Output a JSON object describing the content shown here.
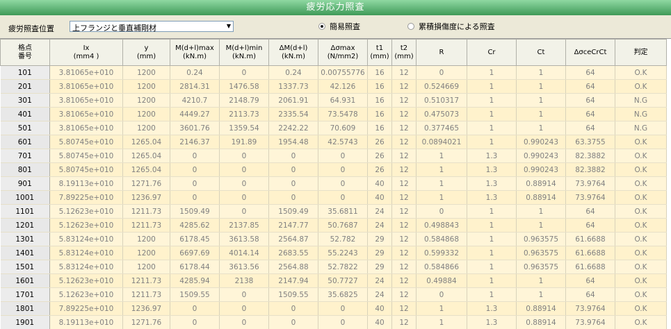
{
  "title": "疲労応力照査",
  "filter": {
    "label": "疲労照査位置",
    "location_value": "上フランジと垂直補剛材",
    "dropdown_icon": "▼",
    "radio_simple": "簡易照査",
    "radio_cumulative": "累積損傷度による照査",
    "selected": "simple"
  },
  "table": {
    "headers": [
      "格点\n番号",
      "Ix\n(mm4 )",
      "y\n(mm)",
      "M(d+l)max\n(kN.m)",
      "M(d+l)min\n(kN.m)",
      "ΔM(d+l)\n(kN.m)",
      "Δσmax\n(N/mm2)",
      "t1\n(mm)",
      "t2\n(mm)",
      "R",
      "Cr",
      "Ct",
      "ΔσceCrCt",
      "判定"
    ],
    "rows": [
      [
        "101",
        "3.81065e+010",
        "1200",
        "0.24",
        "0",
        "0.24",
        "0.00755776",
        "16",
        "12",
        "0",
        "1",
        "1",
        "64",
        "O.K"
      ],
      [
        "201",
        "3.81065e+010",
        "1200",
        "2814.31",
        "1476.58",
        "1337.73",
        "42.126",
        "16",
        "12",
        "0.524669",
        "1",
        "1",
        "64",
        "O.K"
      ],
      [
        "301",
        "3.81065e+010",
        "1200",
        "4210.7",
        "2148.79",
        "2061.91",
        "64.931",
        "16",
        "12",
        "0.510317",
        "1",
        "1",
        "64",
        "N.G"
      ],
      [
        "401",
        "3.81065e+010",
        "1200",
        "4449.27",
        "2113.73",
        "2335.54",
        "73.5478",
        "16",
        "12",
        "0.475073",
        "1",
        "1",
        "64",
        "N.G"
      ],
      [
        "501",
        "3.81065e+010",
        "1200",
        "3601.76",
        "1359.54",
        "2242.22",
        "70.609",
        "16",
        "12",
        "0.377465",
        "1",
        "1",
        "64",
        "N.G"
      ],
      [
        "601",
        "5.80745e+010",
        "1265.04",
        "2146.37",
        "191.89",
        "1954.48",
        "42.5743",
        "26",
        "12",
        "0.0894021",
        "1",
        "0.990243",
        "63.3755",
        "O.K"
      ],
      [
        "701",
        "5.80745e+010",
        "1265.04",
        "0",
        "0",
        "0",
        "0",
        "26",
        "12",
        "1",
        "1.3",
        "0.990243",
        "82.3882",
        "O.K"
      ],
      [
        "801",
        "5.80745e+010",
        "1265.04",
        "0",
        "0",
        "0",
        "0",
        "26",
        "12",
        "1",
        "1.3",
        "0.990243",
        "82.3882",
        "O.K"
      ],
      [
        "901",
        "8.19113e+010",
        "1271.76",
        "0",
        "0",
        "0",
        "0",
        "40",
        "12",
        "1",
        "1.3",
        "0.88914",
        "73.9764",
        "O.K"
      ],
      [
        "1001",
        "7.89225e+010",
        "1236.97",
        "0",
        "0",
        "0",
        "0",
        "40",
        "12",
        "1",
        "1.3",
        "0.88914",
        "73.9764",
        "O.K"
      ],
      [
        "1101",
        "5.12623e+010",
        "1211.73",
        "1509.49",
        "0",
        "1509.49",
        "35.6811",
        "24",
        "12",
        "0",
        "1",
        "1",
        "64",
        "O.K"
      ],
      [
        "1201",
        "5.12623e+010",
        "1211.73",
        "4285.62",
        "2137.85",
        "2147.77",
        "50.7687",
        "24",
        "12",
        "0.498843",
        "1",
        "1",
        "64",
        "O.K"
      ],
      [
        "1301",
        "5.83124e+010",
        "1200",
        "6178.45",
        "3613.58",
        "2564.87",
        "52.782",
        "29",
        "12",
        "0.584868",
        "1",
        "0.963575",
        "61.6688",
        "O.K"
      ],
      [
        "1401",
        "5.83124e+010",
        "1200",
        "6697.69",
        "4014.14",
        "2683.55",
        "55.2243",
        "29",
        "12",
        "0.599332",
        "1",
        "0.963575",
        "61.6688",
        "O.K"
      ],
      [
        "1501",
        "5.83124e+010",
        "1200",
        "6178.44",
        "3613.56",
        "2564.88",
        "52.7822",
        "29",
        "12",
        "0.584866",
        "1",
        "0.963575",
        "61.6688",
        "O.K"
      ],
      [
        "1601",
        "5.12623e+010",
        "1211.73",
        "4285.94",
        "2138",
        "2147.94",
        "50.7727",
        "24",
        "12",
        "0.49884",
        "1",
        "1",
        "64",
        "O.K"
      ],
      [
        "1701",
        "5.12623e+010",
        "1211.73",
        "1509.55",
        "0",
        "1509.55",
        "35.6825",
        "24",
        "12",
        "0",
        "1",
        "1",
        "64",
        "O.K"
      ],
      [
        "1801",
        "7.89225e+010",
        "1236.97",
        "0",
        "0",
        "0",
        "0",
        "40",
        "12",
        "1",
        "1.3",
        "0.88914",
        "73.9764",
        "O.K"
      ],
      [
        "1901",
        "8.19113e+010",
        "1271.76",
        "0",
        "0",
        "0",
        "0",
        "40",
        "12",
        "1",
        "1.3",
        "0.88914",
        "73.9764",
        "O.K"
      ]
    ]
  }
}
